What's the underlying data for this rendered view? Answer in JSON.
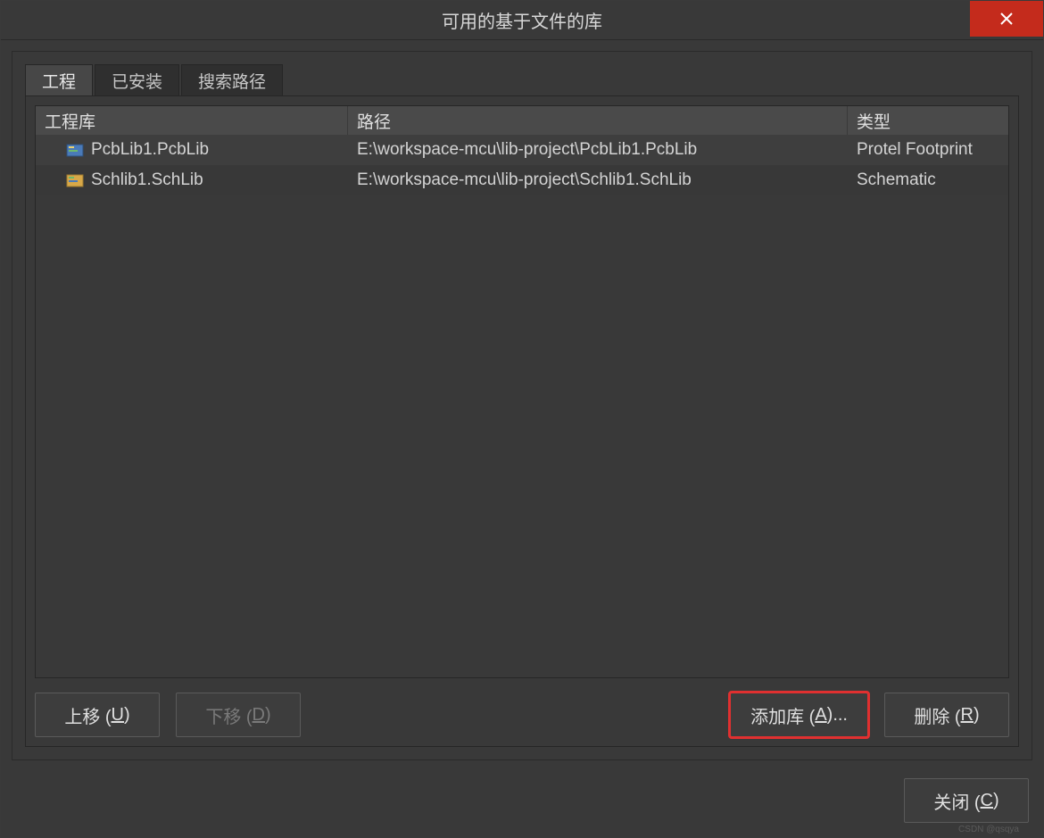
{
  "title": "可用的基于文件的库",
  "tabs": [
    {
      "label": "工程",
      "active": true
    },
    {
      "label": "已安装",
      "active": false
    },
    {
      "label": "搜索路径",
      "active": false
    }
  ],
  "columns": {
    "lib": "工程库",
    "path": "路径",
    "type": "类型"
  },
  "rows": [
    {
      "name": "PcbLib1.PcbLib",
      "path": "E:\\workspace-mcu\\lib-project\\PcbLib1.PcbLib",
      "type": "Protel Footprint",
      "icon": "pcb"
    },
    {
      "name": "Schlib1.SchLib",
      "path": "E:\\workspace-mcu\\lib-project\\Schlib1.SchLib",
      "type": "Schematic",
      "icon": "sch"
    }
  ],
  "buttons": {
    "move_up": "上移 (U)",
    "move_down": "下移 (D)",
    "add_lib": "添加库 (A)...",
    "delete": "删除 (R)",
    "close": "关闭 (C)"
  },
  "watermark": "CSDN @qsqya"
}
